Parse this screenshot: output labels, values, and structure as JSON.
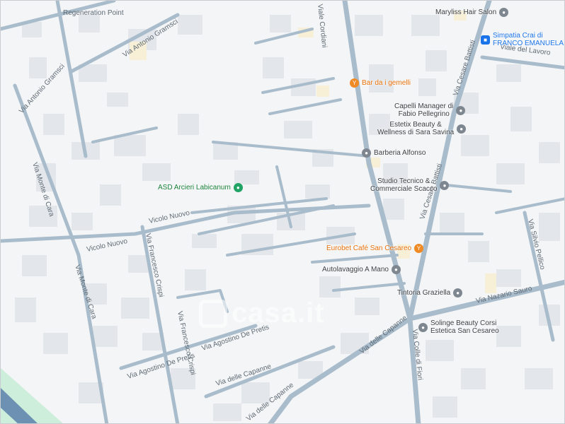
{
  "map": {
    "colors": {
      "road": "#a9bccb",
      "building": "#e3e6ea",
      "background": "#f4f5f7",
      "green_area": "#cdeedb",
      "water": "#6d91b3"
    },
    "streets": [
      "Regeneration Point",
      "Via Antonio Gramsci",
      "Via Antonio Gramsci",
      "Vicolo Nuovo",
      "Vicolo Nuovo",
      "Via Monte di Cara",
      "Via Monte di Cara",
      "Via Francesco Crispi",
      "Via Francesco Crispi",
      "Via Agostino De Pretis",
      "Via Agostino De Pretis",
      "Via delle Capanne",
      "Via delle Capanne",
      "Via delle Capanne",
      "Via Colle di Fiori",
      "Via Cesare Battisti",
      "Via Cesare Battisti",
      "Viale del Lavoro",
      "Via Nazario Sauro",
      "Via Silvio Pellico",
      "Viale Cordiani"
    ],
    "pois": [
      {
        "name_lines": [
          "Maryliss Hair Salon"
        ],
        "kind": "gray",
        "icon": "shop-icon"
      },
      {
        "name_lines": [
          "Simpatia Crai di",
          "FRANCO EMANUELA"
        ],
        "kind": "blue",
        "icon": "shopping-icon"
      },
      {
        "name_lines": [
          "Bar da i gemelli"
        ],
        "kind": "orange",
        "icon": "cafe-icon"
      },
      {
        "name_lines": [
          "Capelli Manager di",
          "Fabio Pellegrino"
        ],
        "kind": "gray",
        "icon": "shop-icon"
      },
      {
        "name_lines": [
          "Estetix Beauty &",
          "Wellness di Sara Savina"
        ],
        "kind": "gray",
        "icon": "shop-icon"
      },
      {
        "name_lines": [
          "Barberia Alfonso"
        ],
        "kind": "gray",
        "icon": "shop-icon"
      },
      {
        "name_lines": [
          "ASD Arcieri Labicanum"
        ],
        "kind": "green",
        "icon": "sports-icon"
      },
      {
        "name_lines": [
          "Studio Tecnico &",
          "Commerciale Scacco"
        ],
        "kind": "gray",
        "icon": "shop-icon"
      },
      {
        "name_lines": [
          "Eurobet Café San Cesareo"
        ],
        "kind": "orange",
        "icon": "cafe-icon"
      },
      {
        "name_lines": [
          "Autolavaggio A Mano"
        ],
        "kind": "gray",
        "icon": "shop-icon"
      },
      {
        "name_lines": [
          "Tintoria Graziella"
        ],
        "kind": "gray",
        "icon": "shop-icon"
      },
      {
        "name_lines": [
          "Solinge Beauty Corsi",
          "Estetica San Cesareo"
        ],
        "kind": "gray",
        "icon": "shop-icon"
      }
    ],
    "watermark": "casa.it"
  }
}
